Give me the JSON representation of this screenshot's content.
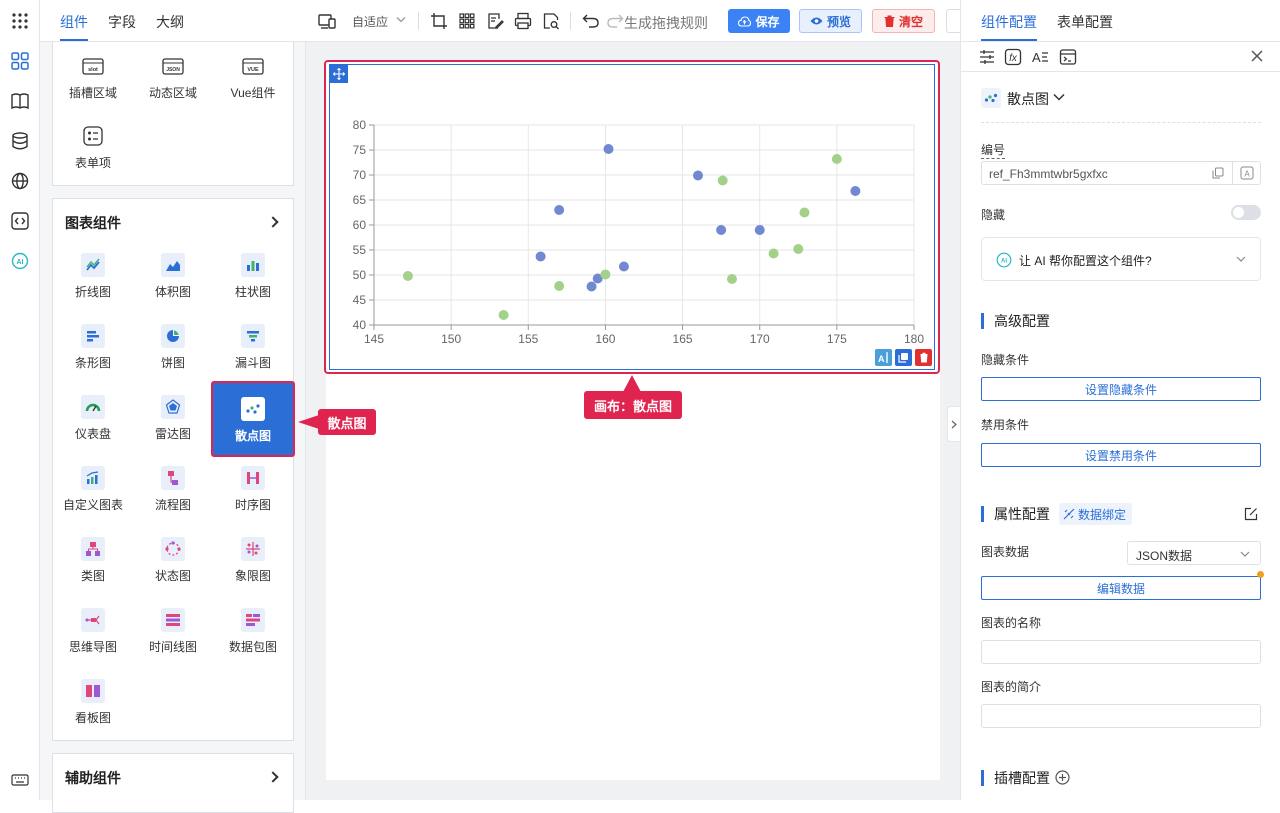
{
  "left_tabs": [
    {
      "label": "组件",
      "active": true
    },
    {
      "label": "字段",
      "active": false
    },
    {
      "label": "大纲",
      "active": false
    }
  ],
  "basic_items": [
    {
      "label": "插槽区域",
      "icon": "slot-icon",
      "icon_text": "slot"
    },
    {
      "label": "动态区域",
      "icon": "json-icon",
      "icon_text": "JSON"
    },
    {
      "label": "Vue组件",
      "icon": "vue-icon",
      "icon_text": "VUE"
    },
    {
      "label": "表单项",
      "icon": "form-item-icon"
    }
  ],
  "chart_section": {
    "title": "图表组件",
    "items": [
      {
        "label": "折线图",
        "icon": "line-chart-icon",
        "color": "#2b6fd6"
      },
      {
        "label": "体积图",
        "icon": "area-chart-icon",
        "color": "#2b6fd6"
      },
      {
        "label": "柱状图",
        "icon": "bar-chart-icon",
        "color": "#2b6fd6"
      },
      {
        "label": "条形图",
        "icon": "horizontal-bar-icon",
        "color": "#2b6fd6"
      },
      {
        "label": "饼图",
        "icon": "pie-chart-icon",
        "color": "#2b6fd6"
      },
      {
        "label": "漏斗图",
        "icon": "funnel-chart-icon",
        "color": "#2b6fd6"
      },
      {
        "label": "仪表盘",
        "icon": "gauge-icon",
        "color": "#1f9d55"
      },
      {
        "label": "雷达图",
        "icon": "radar-chart-icon",
        "color": "#2b6fd6"
      },
      {
        "label": "散点图",
        "icon": "scatter-chart-icon",
        "color": "#2b6fd6",
        "selected": true
      },
      {
        "label": "自定义图表",
        "icon": "custom-chart-icon",
        "color": "#2b6fd6"
      },
      {
        "label": "流程图",
        "icon": "flow-chart-icon",
        "color": "#e0457b"
      },
      {
        "label": "时序图",
        "icon": "sequence-chart-icon",
        "color": "#e0457b"
      },
      {
        "label": "类图",
        "icon": "class-diagram-icon",
        "color": "#e0457b"
      },
      {
        "label": "状态图",
        "icon": "state-diagram-icon",
        "color": "#e0457b"
      },
      {
        "label": "象限图",
        "icon": "quadrant-chart-icon",
        "color": "#e0457b"
      },
      {
        "label": "思维导图",
        "icon": "mind-map-icon",
        "color": "#e0457b"
      },
      {
        "label": "时间线图",
        "icon": "timeline-chart-icon",
        "color": "#e0457b"
      },
      {
        "label": "数据包图",
        "icon": "packet-chart-icon",
        "color": "#e0457b"
      },
      {
        "label": "看板图",
        "icon": "kanban-icon",
        "color": "#e0457b"
      }
    ]
  },
  "aux_section": {
    "title": "辅助组件"
  },
  "toolbar": {
    "fit_label": "自适应",
    "generate_label": "生成拖拽规则",
    "save_label": "保存",
    "preview_label": "预览",
    "clear_label": "清空"
  },
  "callouts": {
    "left": "散点图",
    "canvas": "画布：散点图"
  },
  "right_tabs": [
    {
      "label": "组件配置",
      "active": true
    },
    {
      "label": "表单配置",
      "active": false
    }
  ],
  "right": {
    "component_name": "散点图",
    "id_label": "编号",
    "id_value": "ref_Fh3mmtwbr5gxfxc",
    "hidden_label": "隐藏",
    "ai_prompt": "让 AI 帮你配置这个组件?",
    "advanced_title": "高级配置",
    "hide_condition_label": "隐藏条件",
    "hide_condition_button": "设置隐藏条件",
    "disable_condition_label": "禁用条件",
    "disable_condition_button": "设置禁用条件",
    "props_title": "属性配置",
    "data_binding_label": "数据绑定",
    "chart_data_label": "图表数据",
    "chart_data_select": "JSON数据",
    "edit_data_button": "编辑数据",
    "chart_name_label": "图表的名称",
    "chart_desc_label": "图表的简介",
    "slot_title": "插槽配置"
  },
  "chart_data": {
    "type": "scatter",
    "title": "",
    "xlabel": "",
    "ylabel": "",
    "xlim": [
      145,
      180
    ],
    "ylim": [
      40,
      80
    ],
    "x_ticks": [
      145,
      150,
      155,
      160,
      165,
      170,
      175,
      180
    ],
    "y_ticks": [
      40,
      45,
      50,
      55,
      60,
      65,
      70,
      75,
      80
    ],
    "grid": true,
    "series": [
      {
        "color": "#7289d1",
        "points": [
          [
            155.8,
            53.7
          ],
          [
            157.0,
            63.0
          ],
          [
            160.2,
            75.2
          ],
          [
            159.1,
            47.7
          ],
          [
            159.5,
            49.3
          ],
          [
            161.2,
            51.7
          ],
          [
            166.0,
            69.9
          ],
          [
            167.5,
            59.0
          ],
          [
            170.0,
            59.0
          ],
          [
            176.2,
            66.8
          ]
        ]
      },
      {
        "color": "#a3d18a",
        "points": [
          [
            147.2,
            49.8
          ],
          [
            153.4,
            42.0
          ],
          [
            157.0,
            47.8
          ],
          [
            160.0,
            50.1
          ],
          [
            167.6,
            68.9
          ],
          [
            168.2,
            49.2
          ],
          [
            170.9,
            54.3
          ],
          [
            172.5,
            55.2
          ],
          [
            172.9,
            62.5
          ],
          [
            175.0,
            73.2
          ]
        ]
      }
    ]
  }
}
